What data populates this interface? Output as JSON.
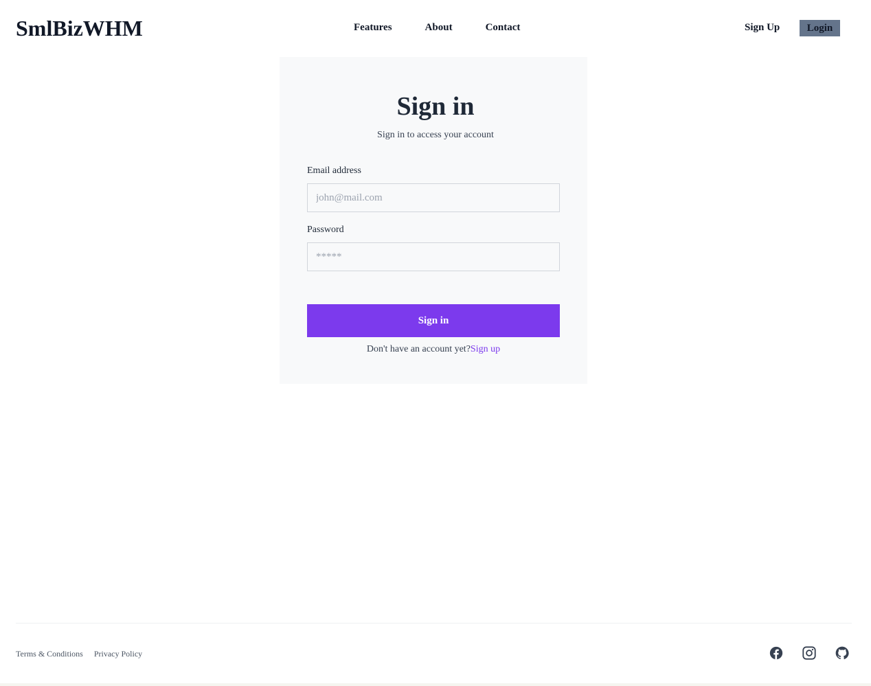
{
  "header": {
    "logo": "SmlBizWHM",
    "nav": [
      {
        "label": "Features"
      },
      {
        "label": "About"
      },
      {
        "label": "Contact"
      }
    ],
    "signup_label": "Sign Up",
    "login_label": "Login"
  },
  "signin": {
    "title": "Sign in",
    "subtitle": "Sign in to access your account",
    "email_label": "Email address",
    "email_placeholder": "john@mail.com",
    "password_label": "Password",
    "password_placeholder": "*****",
    "submit_label": "Sign in",
    "prompt_text": "Don't have an account yet?",
    "prompt_link": "Sign up"
  },
  "footer": {
    "links": [
      {
        "label": "Terms & Conditions"
      },
      {
        "label": "Privacy Policy"
      }
    ],
    "social_icons": [
      "facebook-icon",
      "instagram-icon",
      "github-icon"
    ]
  },
  "colors": {
    "accent": "#7c3aed",
    "login_button": "#64748b",
    "card_background": "#f8f9fa"
  }
}
